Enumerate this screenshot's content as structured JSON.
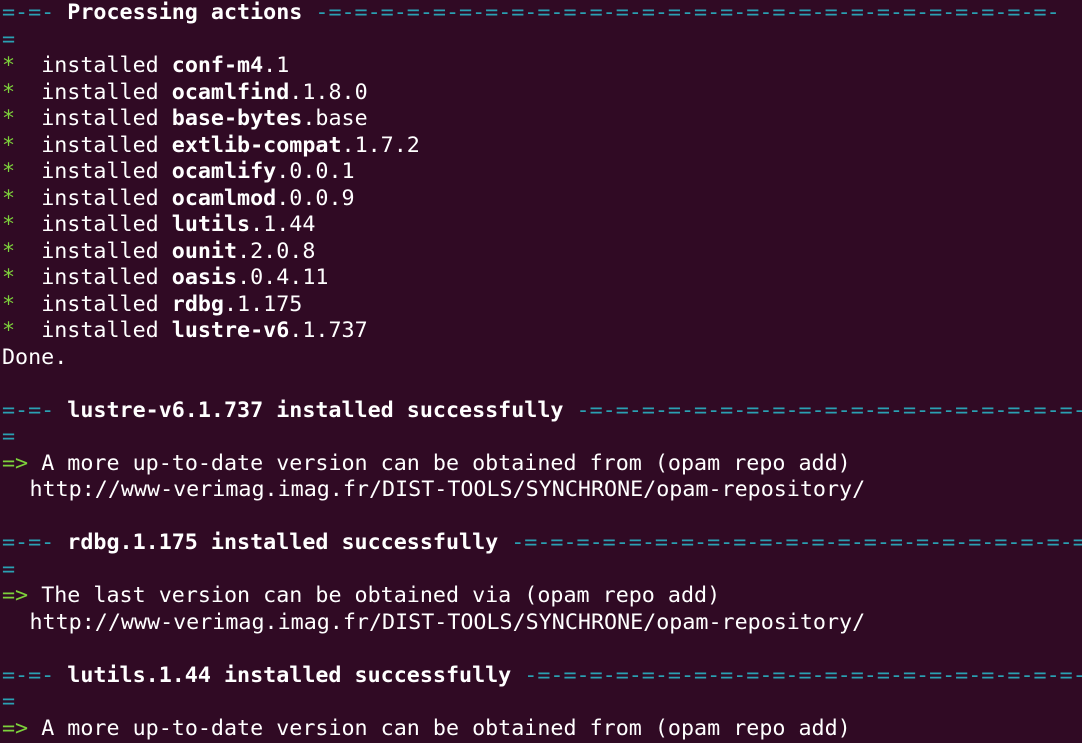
{
  "colors": {
    "background": "#300a24",
    "text": "#ffffff",
    "separator": "#2aa1b3",
    "marker": "#7dd13b"
  },
  "processing": {
    "header_left": "=-=-",
    "title": "Processing actions",
    "header_right": "-=-=-=-=-=-=-=-=-=-=-=-=-=-=-=-=-=-=-=-=-=-=-=-=-=-=-=-=-",
    "wrap": "=",
    "verb": "installed",
    "bullet": "*",
    "items": [
      {
        "name": "conf-m4",
        "version": ".1"
      },
      {
        "name": "ocamlfind",
        "version": ".1.8.0"
      },
      {
        "name": "base-bytes",
        "version": ".base"
      },
      {
        "name": "extlib-compat",
        "version": ".1.7.2"
      },
      {
        "name": "ocamlify",
        "version": ".0.0.1"
      },
      {
        "name": "ocamlmod",
        "version": ".0.0.9"
      },
      {
        "name": "lutils",
        "version": ".1.44"
      },
      {
        "name": "ounit",
        "version": ".2.0.8"
      },
      {
        "name": "oasis",
        "version": ".0.4.11"
      },
      {
        "name": "rdbg",
        "version": ".1.175"
      },
      {
        "name": "lustre-v6",
        "version": ".1.737"
      }
    ],
    "done": "Done."
  },
  "notices": [
    {
      "header_left": "=-=-",
      "title": "lustre-v6.1.737 installed successfully",
      "header_right": "-=-=-=-=-=-=-=-=-=-=-=-=-=-=-=-=-=-=-=-=-=-=-=-=-=-=-=-=-",
      "wrap": "=",
      "arrow": "=>",
      "message": "A more up-to-date version can be obtained from (opam repo add)",
      "url": "http://www-verimag.imag.fr/DIST-TOOLS/SYNCHRONE/opam-repository/"
    },
    {
      "header_left": "=-=-",
      "title": "rdbg.1.175 installed successfully",
      "header_right": "-=-=-=-=-=-=-=-=-=-=-=-=-=-=-=-=-=-=-=-=-=-=-=-=-=-=-=-=-",
      "wrap": "=",
      "arrow": "=>",
      "message": "The last version can be obtained via (opam repo add)",
      "url": "http://www-verimag.imag.fr/DIST-TOOLS/SYNCHRONE/opam-repository/"
    },
    {
      "header_left": "=-=-",
      "title": "lutils.1.44 installed successfully",
      "header_right": "-=-=-=-=-=-=-=-=-=-=-=-=-=-=-=-=-=-=-=-=-=-=-=-=-=-=-=-=-",
      "wrap": "=",
      "arrow": "=>",
      "message": "A more up-to-date version can be obtained from (opam repo add)"
    }
  ]
}
